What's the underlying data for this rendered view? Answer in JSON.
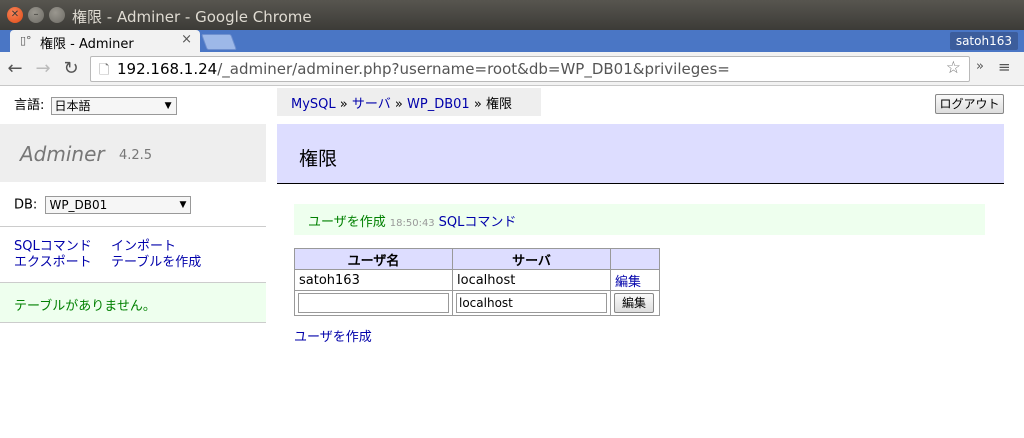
{
  "window": {
    "title": "権限 - Adminer - Google Chrome"
  },
  "tab": {
    "title": "権限 - Adminer",
    "close": "×"
  },
  "profile": {
    "name": "satoh163"
  },
  "toolbar": {
    "url_host": "192.168.1.24",
    "url_path": "/_adminer/adminer.php?username=root&db=WP_DB01&privileges="
  },
  "sidebar": {
    "lang_label": "言語:",
    "lang_value": "日本語",
    "brand_name": "Adminer",
    "brand_version": "4.2.5",
    "db_label": "DB:",
    "db_value": "WP_DB01",
    "links": {
      "sql_command": "SQLコマンド",
      "import": "インポート",
      "export": "エクスポート",
      "create_table": "テーブルを作成"
    },
    "no_tables": "テーブルがありません。"
  },
  "breadcrumb": {
    "mysql": "MySQL",
    "sep": "»",
    "server": "サーバ",
    "db": "WP_DB01",
    "current": "権限"
  },
  "header": {
    "logout": "ログアウト",
    "title": "権限"
  },
  "message": {
    "create_user": "ユーザを作成",
    "time": "18:50:43",
    "sql_command": "SQLコマンド"
  },
  "table": {
    "headers": {
      "user": "ユーザ名",
      "server": "サーバ",
      "action": ""
    },
    "rows": [
      {
        "user": "satoh163",
        "server": "localhost",
        "action": "編集"
      }
    ],
    "new_row": {
      "user": "",
      "server": "localhost",
      "button": "編集"
    }
  },
  "footer_link": {
    "create_user": "ユーザを作成"
  }
}
